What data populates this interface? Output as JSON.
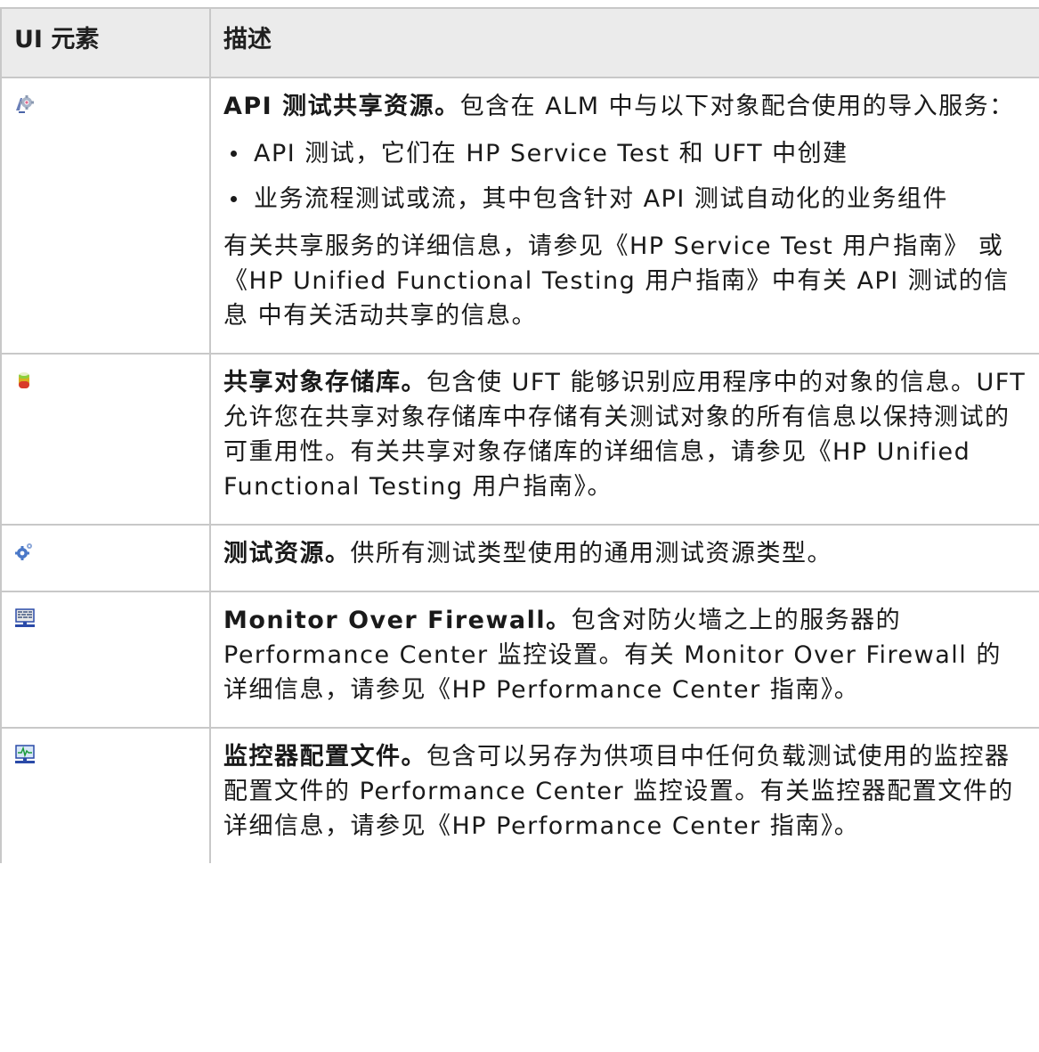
{
  "table": {
    "headers": [
      "UI 元素",
      "描述"
    ],
    "rows": [
      {
        "icon": "api-test-resource-icon",
        "title": "API 测试共享资源。",
        "text": "包含在 ALM 中与以下对象配合使用的导入服务：",
        "bullets": [
          "API 测试，它们在 HP Service Test 和 UFT 中创建",
          "业务流程测试或流，其中包含针对 API 测试自动化的业务组件"
        ],
        "note": "有关共享服务的详细信息，请参见《HP Service Test 用户指南》 或《HP Unified Functional Testing 用户指南》中有关 API 测试的信息 中有关活动共享的信息。"
      },
      {
        "icon": "object-repository-icon",
        "title": "共享对象存储库。",
        "text": "包含使 UFT 能够识别应用程序中的对象的信息。UFT 允许您在共享对象存储库中存储有关测试对象的所有信息以保持测试的可重用性。有关共享对象存储库的详细信息，请参见《HP Unified Functional Testing 用户指南》。"
      },
      {
        "icon": "test-resource-gear-icon",
        "title": "测试资源。",
        "text": "供所有测试类型使用的通用测试资源类型。"
      },
      {
        "icon": "monitor-over-firewall-icon",
        "title": "Monitor Over Firewall。",
        "text": "包含对防火墙之上的服务器的 Performance Center 监控设置。有关 Monitor Over Firewall 的详细信息，请参见《HP Performance Center 指南》。"
      },
      {
        "icon": "monitor-profile-icon",
        "title": "监控器配置文件。",
        "text": "包含可以另存为供项目中任何负载测试使用的监控器配置文件的 Performance Center 监控设置。有关监控器配置文件的详细信息，请参见《HP Performance Center 指南》。"
      }
    ]
  }
}
